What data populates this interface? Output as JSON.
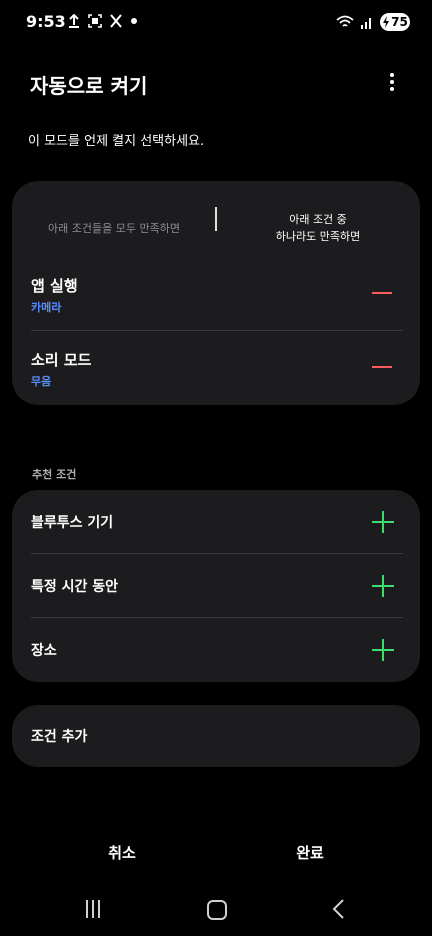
{
  "status_bar": {
    "time": "9:53",
    "battery": "75"
  },
  "header": {
    "title": "자동으로 켜기"
  },
  "description": "이 모드를 언제 켤지 선택하세요.",
  "conditions_card": {
    "option_all": "아래 조건들을 모두 만족하면",
    "option_any_line1": "아래 조건 중",
    "option_any_line2": "하나라도 만족하면",
    "selected_option": "any",
    "items": [
      {
        "title": "앱 실행",
        "subtitle": "카메라"
      },
      {
        "title": "소리 모드",
        "subtitle": "무음"
      }
    ]
  },
  "recommended": {
    "label": "추천 조건",
    "items": [
      {
        "label": "블루투스 기기"
      },
      {
        "label": "특정 시간 동안"
      },
      {
        "label": "장소"
      }
    ]
  },
  "add_condition": {
    "label": "조건 추가"
  },
  "actions": {
    "cancel": "취소",
    "done": "완료"
  },
  "colors": {
    "background": "#000000",
    "card": "#1c1c1e",
    "accent_blue": "#5a8dff",
    "remove_red": "#ff5a5a",
    "add_green": "#3ddc6e"
  },
  "icons": {
    "more": "more-vertical-icon",
    "remove": "minus-icon",
    "add": "plus-icon"
  }
}
